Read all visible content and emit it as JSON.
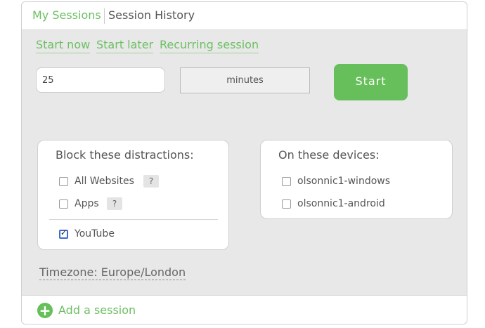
{
  "tabs": {
    "active": "My Sessions",
    "history": "Session History"
  },
  "modes": {
    "start_now": "Start now",
    "start_later": "Start later",
    "recurring": "Recurring session"
  },
  "duration": {
    "value": "25",
    "unit": "minutes"
  },
  "start_button": "Start",
  "block_card": {
    "title": "Block these distractions:",
    "options": [
      {
        "label": "All Websites",
        "checked": false,
        "help": "?"
      },
      {
        "label": "Apps",
        "checked": false,
        "help": "?"
      },
      {
        "label": "YouTube",
        "checked": true
      }
    ]
  },
  "devices_card": {
    "title": "On these devices:",
    "options": [
      {
        "label": "olsonnic1-windows",
        "checked": false
      },
      {
        "label": "olsonnic1-android",
        "checked": false
      }
    ]
  },
  "timezone": "Timezone: Europe/London",
  "footer": {
    "add_icon": "+",
    "add_label": "Add a session"
  },
  "colors": {
    "accent": "#66bf5a",
    "link": "#6dbf63",
    "panel_bg": "#e8e8e8"
  }
}
